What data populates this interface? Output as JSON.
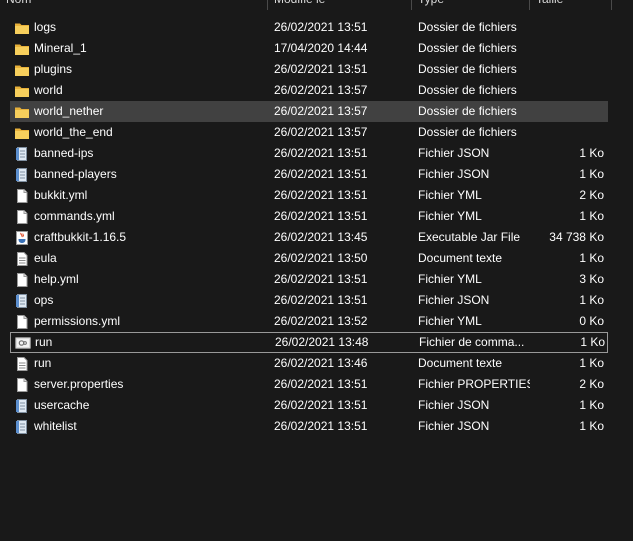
{
  "columns": {
    "name": "Nom",
    "modified": "Modifié le",
    "type": "Type",
    "size": "Taille"
  },
  "files": [
    {
      "name": "logs",
      "modified": "26/02/2021 13:51",
      "type": "Dossier de fichiers",
      "size": "",
      "icon": "folder-icon"
    },
    {
      "name": "Mineral_1",
      "modified": "17/04/2020 14:44",
      "type": "Dossier de fichiers",
      "size": "",
      "icon": "folder-icon"
    },
    {
      "name": "plugins",
      "modified": "26/02/2021 13:51",
      "type": "Dossier de fichiers",
      "size": "",
      "icon": "folder-icon"
    },
    {
      "name": "world",
      "modified": "26/02/2021 13:57",
      "type": "Dossier de fichiers",
      "size": "",
      "icon": "folder-icon"
    },
    {
      "name": "world_nether",
      "modified": "26/02/2021 13:57",
      "type": "Dossier de fichiers",
      "size": "",
      "icon": "folder-icon",
      "selected": true
    },
    {
      "name": "world_the_end",
      "modified": "26/02/2021 13:57",
      "type": "Dossier de fichiers",
      "size": "",
      "icon": "folder-icon"
    },
    {
      "name": "banned-ips",
      "modified": "26/02/2021 13:51",
      "type": "Fichier JSON",
      "size": "1 Ko",
      "icon": "json-file-icon"
    },
    {
      "name": "banned-players",
      "modified": "26/02/2021 13:51",
      "type": "Fichier JSON",
      "size": "1 Ko",
      "icon": "json-file-icon"
    },
    {
      "name": "bukkit.yml",
      "modified": "26/02/2021 13:51",
      "type": "Fichier YML",
      "size": "2 Ko",
      "icon": "file-icon"
    },
    {
      "name": "commands.yml",
      "modified": "26/02/2021 13:51",
      "type": "Fichier YML",
      "size": "1 Ko",
      "icon": "file-icon"
    },
    {
      "name": "craftbukkit-1.16.5",
      "modified": "26/02/2021 13:45",
      "type": "Executable Jar File",
      "size": "34 738 Ko",
      "icon": "java-jar-icon"
    },
    {
      "name": "eula",
      "modified": "26/02/2021 13:50",
      "type": "Document texte",
      "size": "1 Ko",
      "icon": "text-file-icon"
    },
    {
      "name": "help.yml",
      "modified": "26/02/2021 13:51",
      "type": "Fichier YML",
      "size": "3 Ko",
      "icon": "file-icon"
    },
    {
      "name": "ops",
      "modified": "26/02/2021 13:51",
      "type": "Fichier JSON",
      "size": "1 Ko",
      "icon": "json-file-icon"
    },
    {
      "name": "permissions.yml",
      "modified": "26/02/2021 13:52",
      "type": "Fichier YML",
      "size": "0 Ko",
      "icon": "file-icon"
    },
    {
      "name": "run",
      "modified": "26/02/2021 13:48",
      "type": "Fichier de comma...",
      "size": "1 Ko",
      "icon": "batch-file-icon",
      "focused": true
    },
    {
      "name": "run",
      "modified": "26/02/2021 13:46",
      "type": "Document texte",
      "size": "1 Ko",
      "icon": "text-file-icon"
    },
    {
      "name": "server.properties",
      "modified": "26/02/2021 13:51",
      "type": "Fichier PROPERTIES",
      "size": "2 Ko",
      "icon": "file-icon"
    },
    {
      "name": "usercache",
      "modified": "26/02/2021 13:51",
      "type": "Fichier JSON",
      "size": "1 Ko",
      "icon": "json-file-icon"
    },
    {
      "name": "whitelist",
      "modified": "26/02/2021 13:51",
      "type": "Fichier JSON",
      "size": "1 Ko",
      "icon": "json-file-icon"
    }
  ],
  "colors": {
    "background": "#191919",
    "selected_row": "#414141",
    "folder": "#f3c64d",
    "text": "#ffffff"
  }
}
